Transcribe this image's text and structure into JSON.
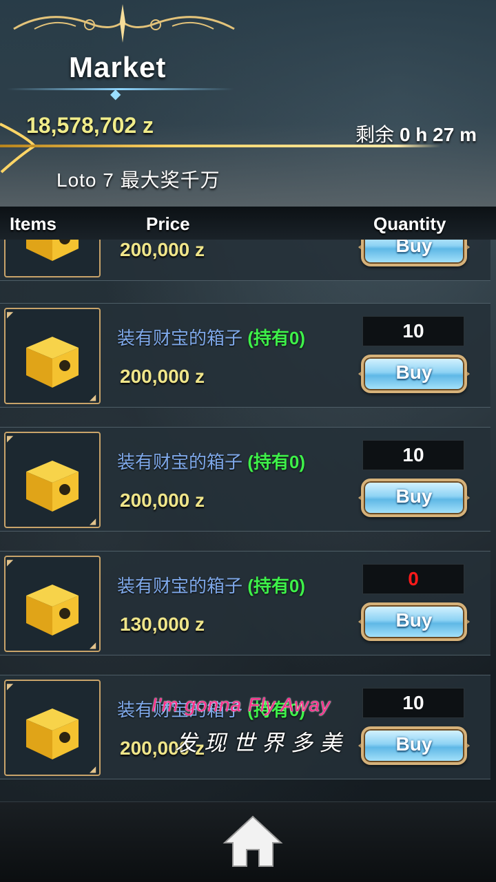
{
  "header": {
    "title": "Market",
    "money": "18,578,702 z",
    "timer_prefix": "剩余",
    "timer_value": "0 h 27 m",
    "banner": "Loto 7 最大奖千万"
  },
  "columns": {
    "items": "Items",
    "price": "Price",
    "quantity": "Quantity"
  },
  "items": [
    {
      "name": "",
      "owned": "",
      "price": "200,000 z",
      "quantity": "",
      "buy_label": "Buy"
    },
    {
      "name": "装有财宝的箱子",
      "owned": "(持有0)",
      "price": "200,000 z",
      "quantity": "10",
      "buy_label": "Buy"
    },
    {
      "name": "装有财宝的箱子",
      "owned": "(持有0)",
      "price": "200,000 z",
      "quantity": "10",
      "buy_label": "Buy"
    },
    {
      "name": "装有财宝的箱子",
      "owned": "(持有0)",
      "price": "130,000 z",
      "quantity": "0",
      "buy_label": "Buy"
    },
    {
      "name": "装有财宝的箱子",
      "owned": "(持有0)",
      "price": "200,000 z",
      "quantity": "10",
      "buy_label": "Buy"
    }
  ],
  "overlay": {
    "lyric_line1": "I'm gonna Fly Away",
    "lyric_line2": "发现世界多美"
  },
  "footer": {
    "home_icon": "home-icon"
  },
  "colors": {
    "price": "#efe58a",
    "owned": "#3ef04a",
    "item_name": "#7fa9ea",
    "zero_quantity": "#ff1a1a"
  }
}
